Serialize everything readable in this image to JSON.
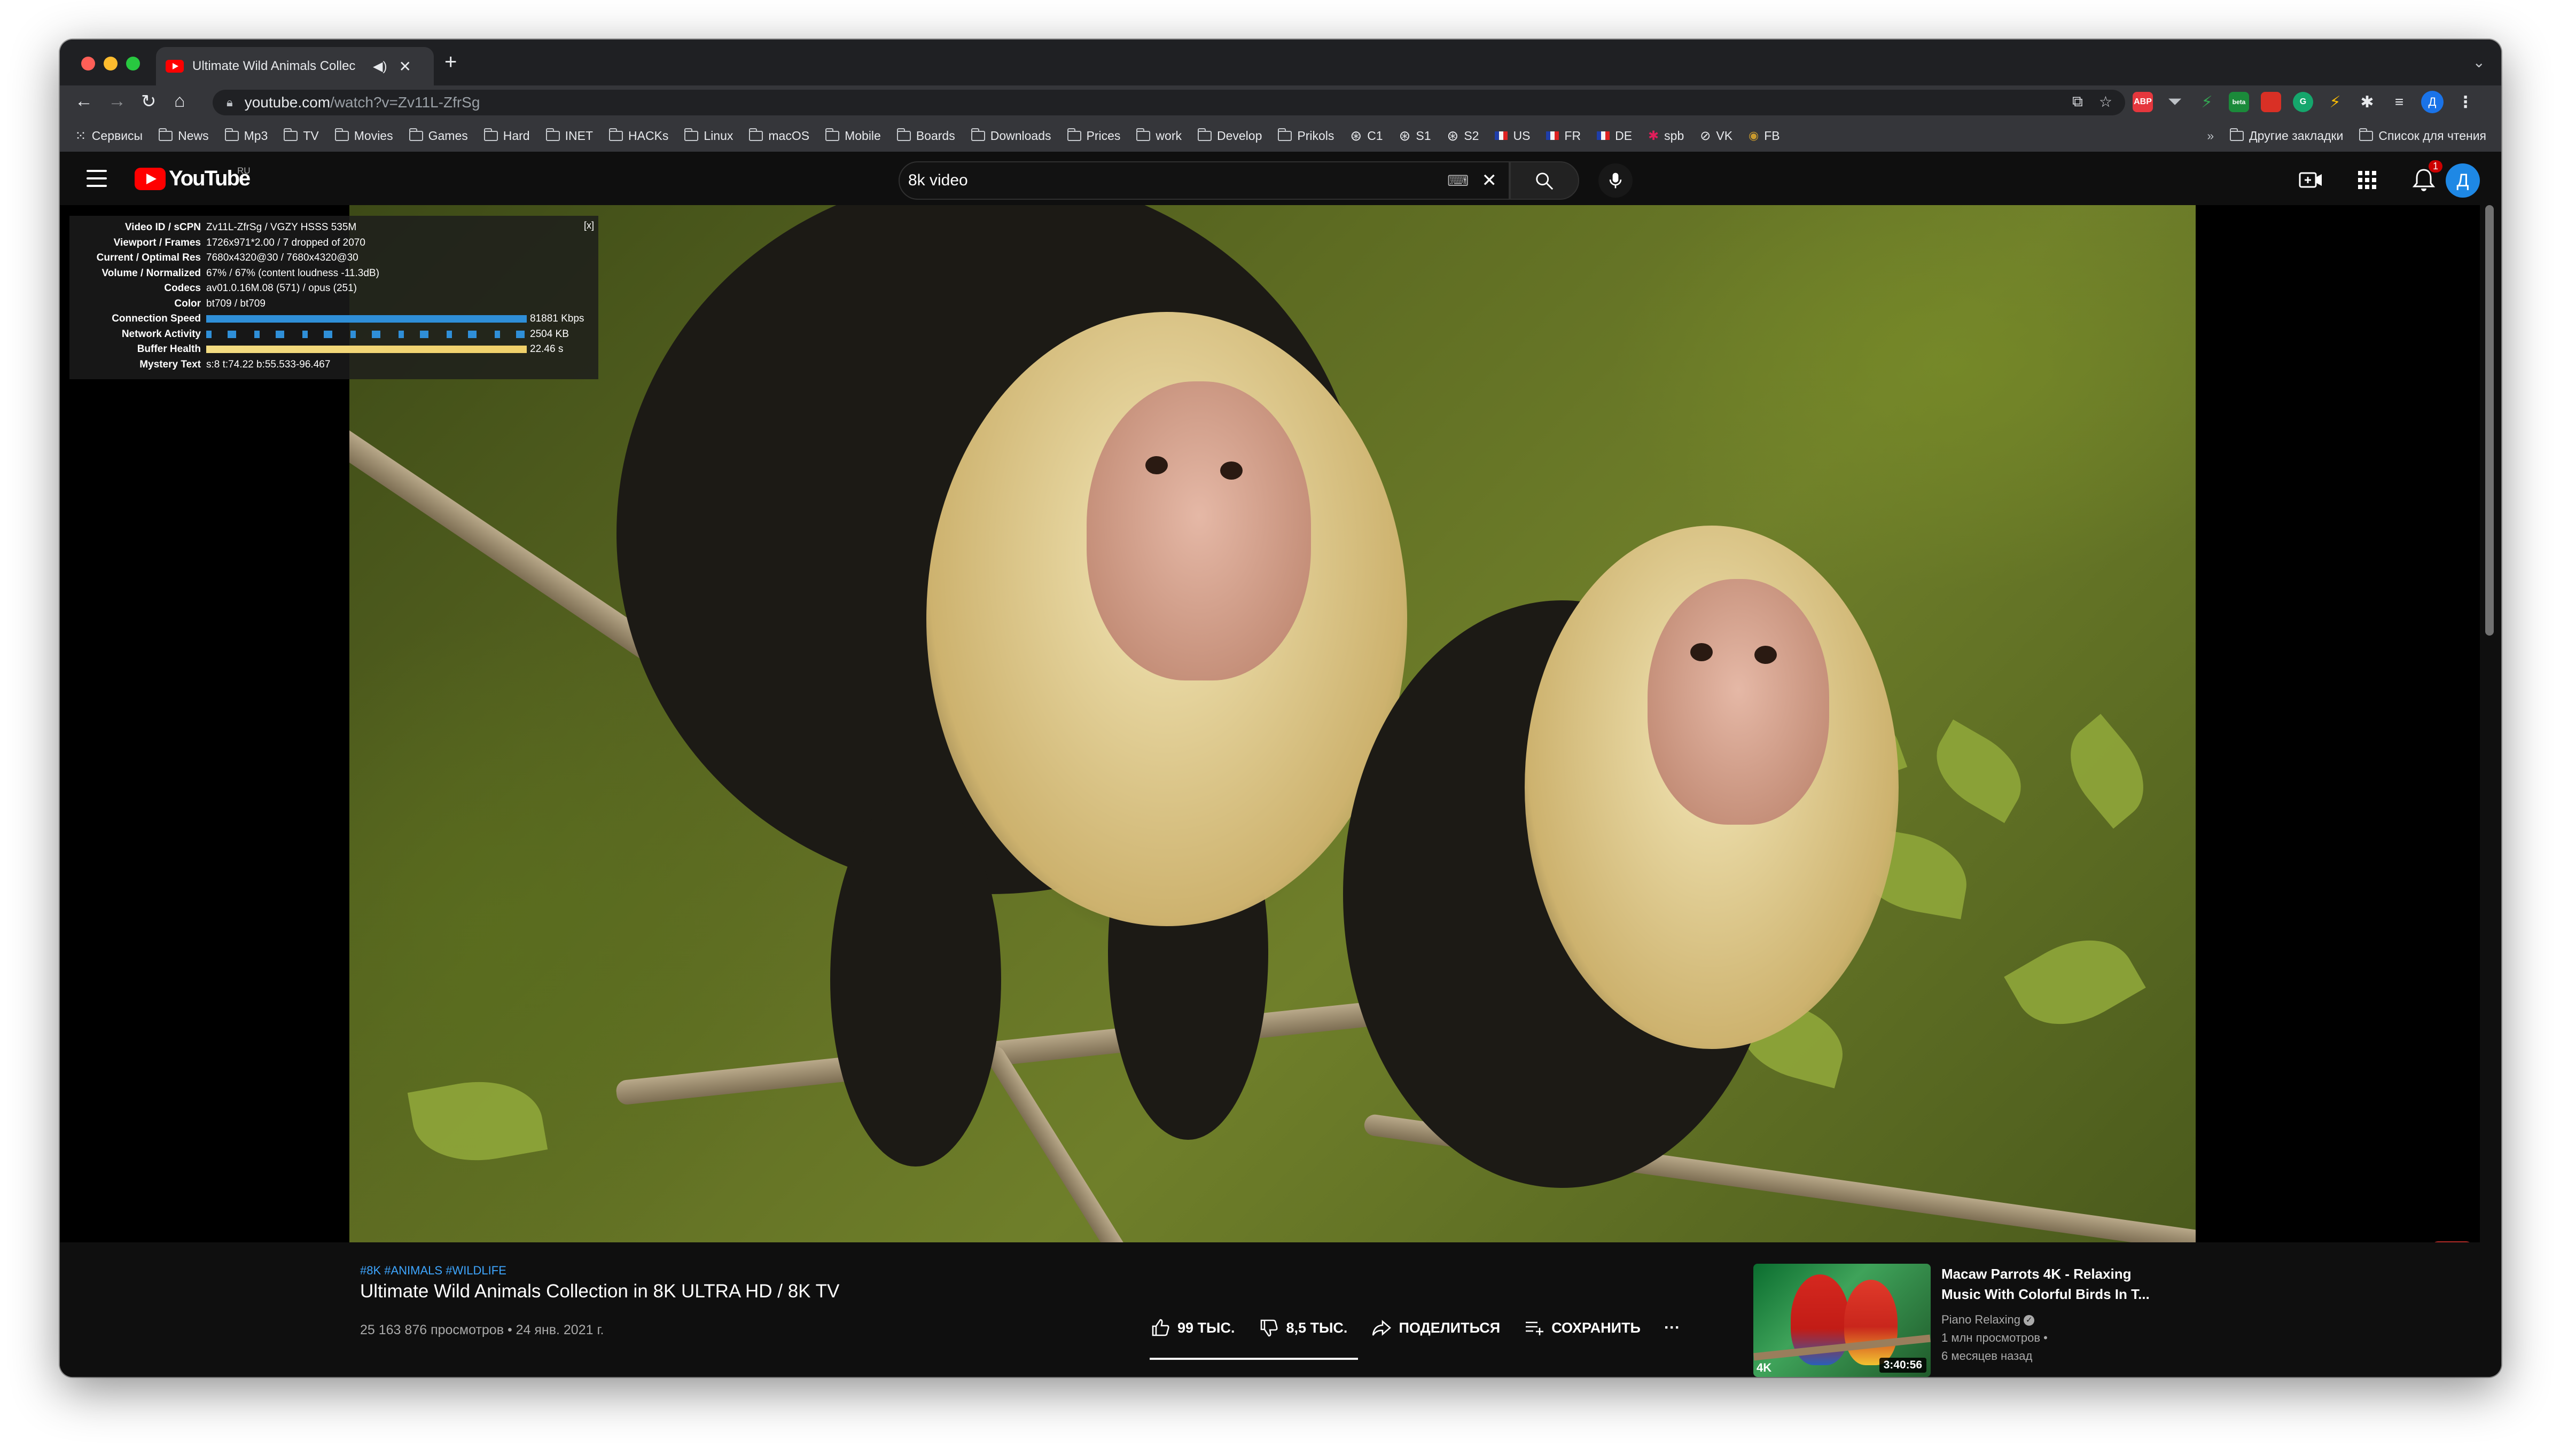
{
  "browser": {
    "tab": {
      "title": "Ultimate Wild Animals Collec",
      "audio_icon": "speaker-icon",
      "close": "✕"
    },
    "new_tab": "+",
    "address": {
      "host": "youtube.com",
      "path": "/watch?v=Zv11L-ZfrSg"
    },
    "extensions": [
      {
        "label": "ABP",
        "color": "#e6373d"
      },
      {
        "label": "",
        "color": "#5f6368"
      },
      {
        "label": "",
        "color": "#2e7d32"
      },
      {
        "label": "beta",
        "color": "#1b8a3a"
      },
      {
        "label": "",
        "color": "#d93025"
      },
      {
        "label": "",
        "color": "#15a66c"
      },
      {
        "label": "",
        "color": "#fbbc04"
      }
    ],
    "profile_initial": "Д",
    "bookmarks": [
      {
        "label": "Сервисы",
        "icon": "apps-grid-icon"
      },
      {
        "label": "News",
        "icon": "folder-icon"
      },
      {
        "label": "Mp3",
        "icon": "folder-icon"
      },
      {
        "label": "TV",
        "icon": "folder-icon"
      },
      {
        "label": "Movies",
        "icon": "folder-icon"
      },
      {
        "label": "Games",
        "icon": "folder-icon"
      },
      {
        "label": "Hard",
        "icon": "folder-icon"
      },
      {
        "label": "INET",
        "icon": "folder-icon"
      },
      {
        "label": "HACKs",
        "icon": "folder-icon"
      },
      {
        "label": "Linux",
        "icon": "folder-icon"
      },
      {
        "label": "macOS",
        "icon": "folder-icon"
      },
      {
        "label": "Mobile",
        "icon": "folder-icon"
      },
      {
        "label": "Boards",
        "icon": "folder-icon"
      },
      {
        "label": "Downloads",
        "icon": "folder-icon"
      },
      {
        "label": "Prices",
        "icon": "folder-icon"
      },
      {
        "label": "work",
        "icon": "folder-icon"
      },
      {
        "label": "Develop",
        "icon": "folder-icon"
      },
      {
        "label": "Prikols",
        "icon": "folder-icon"
      },
      {
        "label": "C1",
        "icon": "globe-icon"
      },
      {
        "label": "S1",
        "icon": "globe-icon"
      },
      {
        "label": "S2",
        "icon": "globe-icon"
      },
      {
        "label": "US",
        "icon": "flag-icon"
      },
      {
        "label": "FR",
        "icon": "flag-icon"
      },
      {
        "label": "DE",
        "icon": "flag-icon"
      },
      {
        "label": "spb",
        "icon": "slack-icon"
      },
      {
        "label": "VK",
        "icon": "vk-icon"
      },
      {
        "label": "FB",
        "icon": "facebook-icon"
      }
    ],
    "bookmarks_more": "»",
    "bookmarks_other": "Другие закладки",
    "reading_list": "Список для чтения"
  },
  "youtube": {
    "logo_text": "YouTube",
    "region": "RU",
    "search": {
      "query": "8k video"
    },
    "notifications_count": "1",
    "avatar_initial": "Д"
  },
  "stats": {
    "close": "[x]",
    "rows": [
      {
        "label": "Video ID / sCPN",
        "value": "Zv11L-ZfrSg / VGZY HSSS 535M"
      },
      {
        "label": "Viewport / Frames",
        "value": "1726x971*2.00 / 7 dropped of 2070"
      },
      {
        "label": "Current / Optimal Res",
        "value": "7680x4320@30 / 7680x4320@30"
      },
      {
        "label": "Volume / Normalized",
        "value": "67% / 67% (content loudness -11.3dB)"
      },
      {
        "label": "Codecs",
        "value": "av01.0.16M.08 (571) / opus (251)"
      },
      {
        "label": "Color",
        "value": "bt709 / bt709"
      }
    ],
    "bars": [
      {
        "label": "Connection Speed",
        "value": "81881 Kbps",
        "style": "blue"
      },
      {
        "label": "Network Activity",
        "value": "2504 KB",
        "style": "act"
      },
      {
        "label": "Buffer Health",
        "value": "22.46 s",
        "style": "yellow"
      }
    ],
    "mystery": {
      "label": "Mystery Text",
      "value": "s:8 t:74.22 b:55.533-96.467"
    }
  },
  "video": {
    "hashtags": "#8K #ANIMALS #WILDLIFE",
    "title": "Ultimate Wild Animals Collection in 8K ULTRA HD / 8K TV",
    "meta": "25 163 876 просмотров • 24 янв. 2021 г.",
    "likes": "99 ТЫС.",
    "dislikes": "8,5 ТЫС.",
    "share": "ПОДЕЛИТЬСЯ",
    "save": "СОХРАНИТЬ",
    "more": "···"
  },
  "related": {
    "title": "Macaw Parrots 4K - Relaxing Music With Colorful Birds In T...",
    "channel": "Piano Relaxing",
    "views": "1 млн просмотров •",
    "age": "6 месяцев назад",
    "duration": "3:40:56",
    "badge": "4K"
  }
}
